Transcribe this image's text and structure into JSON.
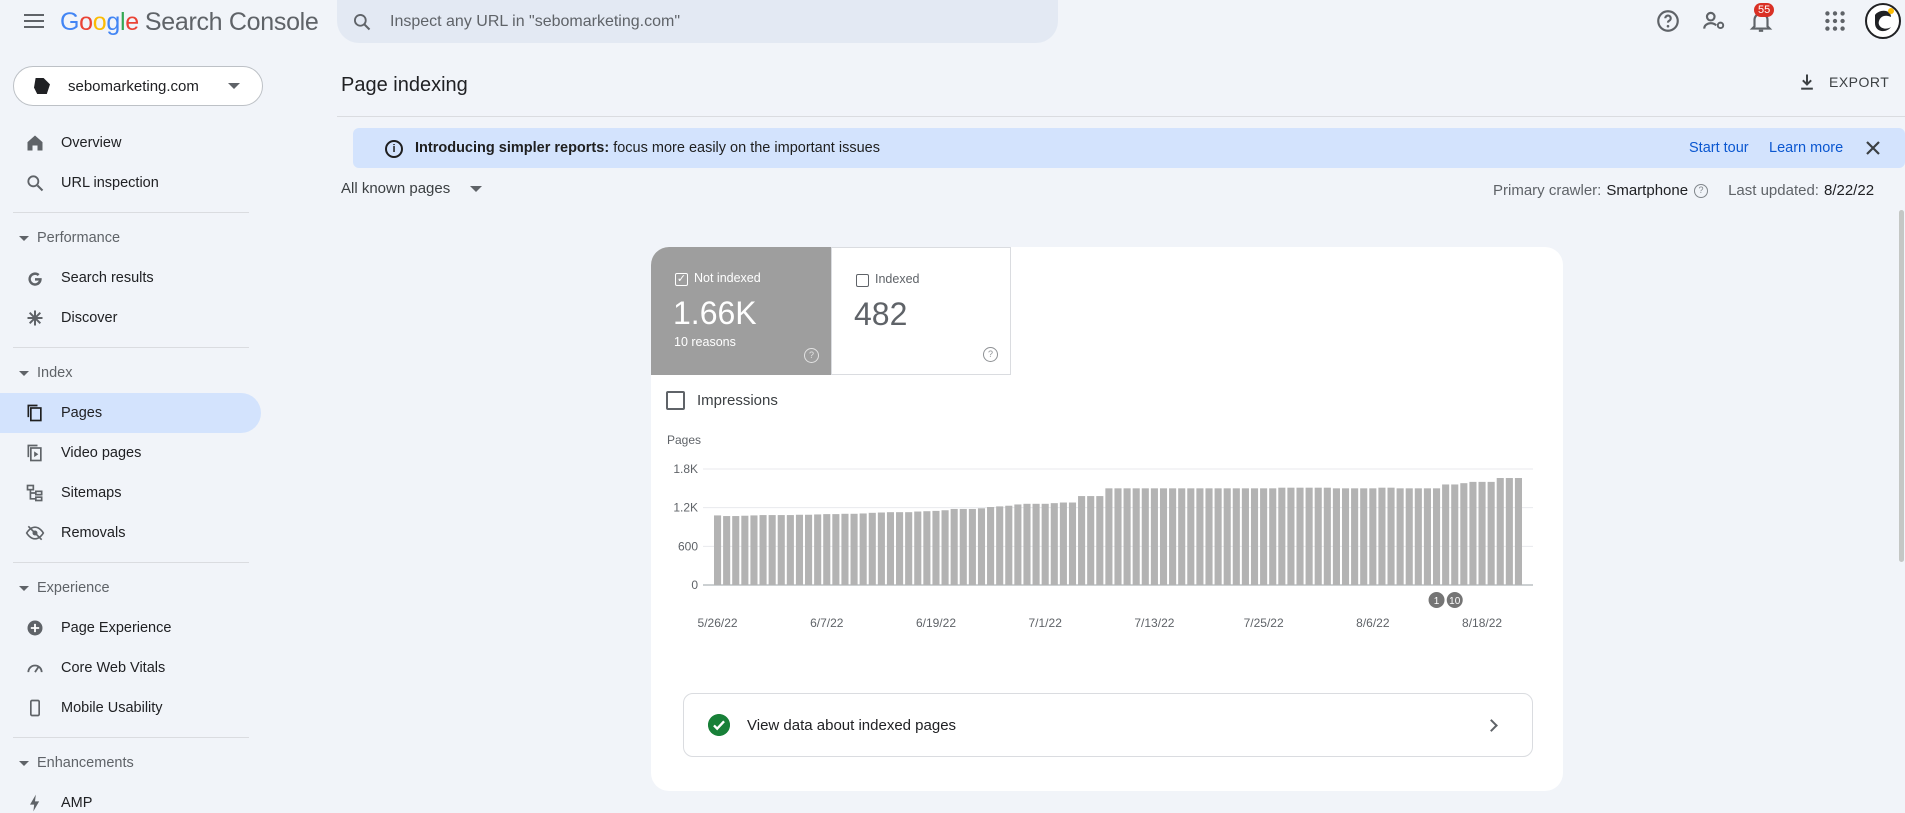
{
  "app": {
    "logo_letters": [
      "G",
      "o",
      "o",
      "g",
      "l",
      "e"
    ],
    "product": "Search Console"
  },
  "search": {
    "placeholder": "Inspect any URL in \"sebomarketing.com\""
  },
  "notifications": {
    "count": "55"
  },
  "property": {
    "name": "sebomarketing.com"
  },
  "sidebar": {
    "top_items": [
      {
        "label": "Overview",
        "icon": "home-icon"
      },
      {
        "label": "URL inspection",
        "icon": "search-icon"
      }
    ],
    "sections": [
      {
        "title": "Performance",
        "items": [
          {
            "label": "Search results",
            "icon": "google-g-icon"
          },
          {
            "label": "Discover",
            "icon": "asterisk-icon"
          }
        ]
      },
      {
        "title": "Index",
        "items": [
          {
            "label": "Pages",
            "icon": "pages-icon",
            "active": true
          },
          {
            "label": "Video pages",
            "icon": "video-pages-icon"
          },
          {
            "label": "Sitemaps",
            "icon": "sitemap-icon"
          },
          {
            "label": "Removals",
            "icon": "eye-off-icon"
          }
        ]
      },
      {
        "title": "Experience",
        "items": [
          {
            "label": "Page Experience",
            "icon": "plus-circle-icon"
          },
          {
            "label": "Core Web Vitals",
            "icon": "gauge-icon"
          },
          {
            "label": "Mobile Usability",
            "icon": "phone-icon"
          }
        ]
      },
      {
        "title": "Enhancements",
        "items": [
          {
            "label": "AMP",
            "icon": "bolt-icon"
          }
        ]
      }
    ]
  },
  "header": {
    "title": "Page indexing",
    "export_label": "EXPORT"
  },
  "banner": {
    "bold": "Introducing simpler reports:",
    "text": " focus more easily on the important issues",
    "start_tour": "Start tour",
    "learn_more": "Learn more"
  },
  "filter": {
    "selected": "All known pages"
  },
  "crawler": {
    "label": "Primary crawler:",
    "value": "Smartphone",
    "updated_label": "Last updated:",
    "updated_value": "8/22/22"
  },
  "tiles": {
    "not_indexed": {
      "title": "Not indexed",
      "value": "1.66K",
      "sub": "10 reasons",
      "checked": true
    },
    "indexed": {
      "title": "Indexed",
      "value": "482",
      "checked": false
    }
  },
  "impressions": {
    "label": "Impressions",
    "checked": false
  },
  "chart_data": {
    "type": "bar",
    "ylabel": "Pages",
    "ylim": [
      0,
      1800
    ],
    "yticks": [
      "0",
      "600",
      "1.2K",
      "1.8K"
    ],
    "ytick_values": [
      0,
      600,
      1200,
      1800
    ],
    "xtick_labels": [
      "5/26/22",
      "6/7/22",
      "6/19/22",
      "7/1/22",
      "7/13/22",
      "7/25/22",
      "8/6/22",
      "8/18/22"
    ],
    "xtick_indices": [
      0,
      12,
      24,
      36,
      48,
      60,
      72,
      84
    ],
    "annotations": [
      {
        "label": "1",
        "index": 79
      },
      {
        "label": "10",
        "index": 81
      }
    ],
    "bar_color": "#b3b3b3",
    "values": [
      1080,
      1070,
      1070,
      1075,
      1080,
      1085,
      1085,
      1085,
      1085,
      1090,
      1090,
      1095,
      1100,
      1100,
      1105,
      1105,
      1110,
      1120,
      1125,
      1130,
      1130,
      1130,
      1140,
      1145,
      1150,
      1160,
      1180,
      1180,
      1180,
      1190,
      1210,
      1220,
      1230,
      1250,
      1260,
      1260,
      1260,
      1270,
      1280,
      1280,
      1380,
      1380,
      1380,
      1500,
      1500,
      1500,
      1500,
      1500,
      1500,
      1500,
      1500,
      1500,
      1500,
      1500,
      1500,
      1500,
      1500,
      1500,
      1500,
      1500,
      1500,
      1500,
      1510,
      1510,
      1510,
      1510,
      1510,
      1510,
      1500,
      1500,
      1500,
      1500,
      1500,
      1510,
      1510,
      1500,
      1500,
      1500,
      1500,
      1500,
      1560,
      1560,
      1580,
      1600,
      1600,
      1600,
      1660,
      1660,
      1660
    ]
  },
  "view_indexed": {
    "label": "View data about indexed pages"
  }
}
